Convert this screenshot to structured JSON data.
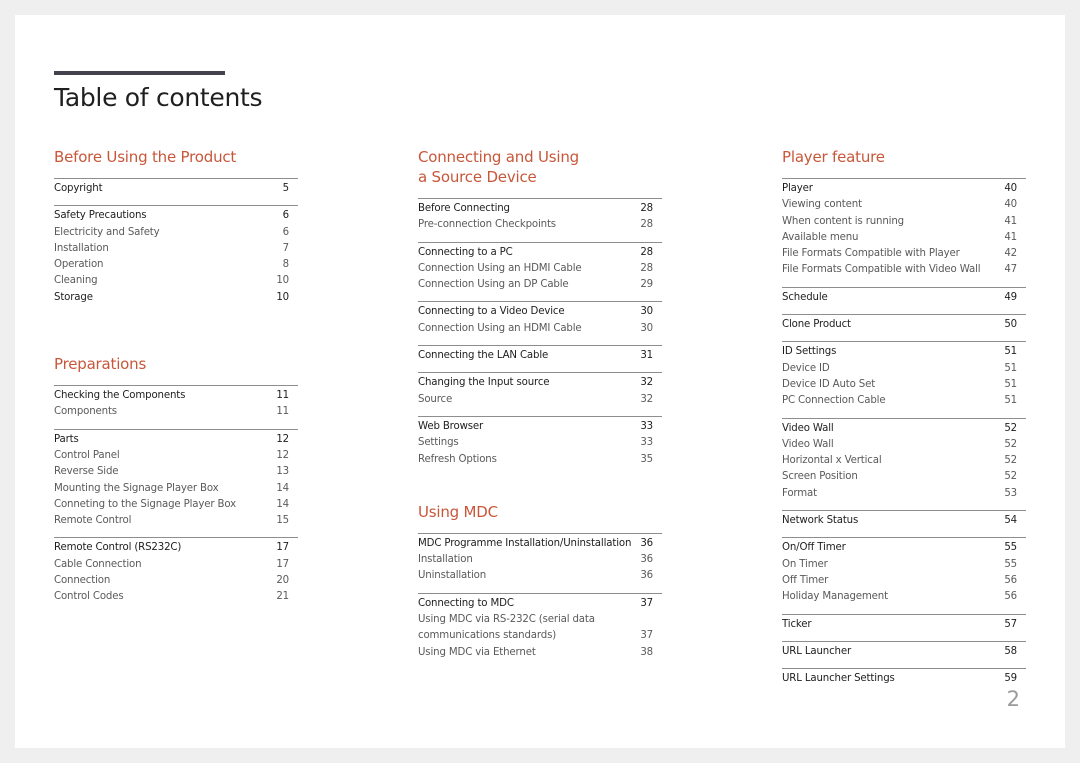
{
  "page": {
    "title": "Table of contents",
    "page_number": "2",
    "accent_color": "#c8573a"
  },
  "columns": [
    {
      "sections": [
        {
          "title": "Before Using the Product",
          "groups": [
            {
              "entries": [
                {
                  "label": "Copyright",
                  "page": "5",
                  "level": "main"
                }
              ]
            },
            {
              "entries": [
                {
                  "label": "Safety Precautions",
                  "page": "6",
                  "level": "main"
                },
                {
                  "label": "Electricity and Safety",
                  "page": "6",
                  "level": "sub"
                },
                {
                  "label": "Installation",
                  "page": "7",
                  "level": "sub"
                },
                {
                  "label": "Operation",
                  "page": "8",
                  "level": "sub"
                },
                {
                  "label": "Cleaning",
                  "page": "10",
                  "level": "sub"
                },
                {
                  "label": "Storage",
                  "page": "10",
                  "level": "main"
                }
              ]
            }
          ]
        },
        {
          "title": "Preparations",
          "groups": [
            {
              "entries": [
                {
                  "label": "Checking the Components",
                  "page": "11",
                  "level": "main"
                },
                {
                  "label": "Components",
                  "page": "11",
                  "level": "sub"
                }
              ]
            },
            {
              "entries": [
                {
                  "label": "Parts",
                  "page": "12",
                  "level": "main"
                },
                {
                  "label": "Control Panel",
                  "page": "12",
                  "level": "sub"
                },
                {
                  "label": "Reverse Side",
                  "page": "13",
                  "level": "sub"
                },
                {
                  "label": "Mounting the Signage Player Box",
                  "page": "14",
                  "level": "sub"
                },
                {
                  "label": "Conneting to the Signage Player Box",
                  "page": "14",
                  "level": "sub"
                },
                {
                  "label": "Remote Control",
                  "page": "15",
                  "level": "sub"
                }
              ]
            },
            {
              "entries": [
                {
                  "label": "Remote Control (RS232C)",
                  "page": "17",
                  "level": "main"
                },
                {
                  "label": "Cable Connection",
                  "page": "17",
                  "level": "sub"
                },
                {
                  "label": "Connection",
                  "page": "20",
                  "level": "sub"
                },
                {
                  "label": "Control Codes",
                  "page": "21",
                  "level": "sub"
                }
              ]
            }
          ]
        }
      ]
    },
    {
      "sections": [
        {
          "title": "Connecting and Using\na Source Device",
          "groups": [
            {
              "entries": [
                {
                  "label": "Before Connecting",
                  "page": "28",
                  "level": "main"
                },
                {
                  "label": "Pre-connection Checkpoints",
                  "page": "28",
                  "level": "sub"
                }
              ]
            },
            {
              "entries": [
                {
                  "label": "Connecting to a PC",
                  "page": "28",
                  "level": "main"
                },
                {
                  "label": "Connection Using an HDMI Cable",
                  "page": "28",
                  "level": "sub"
                },
                {
                  "label": "Connection Using an DP Cable",
                  "page": "29",
                  "level": "sub"
                }
              ]
            },
            {
              "entries": [
                {
                  "label": "Connecting to a Video Device",
                  "page": "30",
                  "level": "main"
                },
                {
                  "label": "Connection Using an HDMI Cable",
                  "page": "30",
                  "level": "sub"
                }
              ]
            },
            {
              "entries": [
                {
                  "label": "Connecting the LAN Cable",
                  "page": "31",
                  "level": "main"
                }
              ]
            },
            {
              "entries": [
                {
                  "label": "Changing the Input source",
                  "page": "32",
                  "level": "main"
                },
                {
                  "label": "Source",
                  "page": "32",
                  "level": "sub"
                }
              ]
            },
            {
              "entries": [
                {
                  "label": "Web Browser",
                  "page": "33",
                  "level": "main"
                },
                {
                  "label": "Settings",
                  "page": "33",
                  "level": "sub"
                },
                {
                  "label": "Refresh Options",
                  "page": "35",
                  "level": "sub"
                }
              ]
            }
          ]
        },
        {
          "title": "Using MDC",
          "groups": [
            {
              "entries": [
                {
                  "label": "MDC Programme Installation/Uninstallation",
                  "page": "36",
                  "level": "main"
                },
                {
                  "label": "Installation",
                  "page": "36",
                  "level": "sub"
                },
                {
                  "label": "Uninstallation",
                  "page": "36",
                  "level": "sub"
                }
              ]
            },
            {
              "entries": [
                {
                  "label": "Connecting to MDC",
                  "page": "37",
                  "level": "main"
                },
                {
                  "label": "Using MDC via RS-232C (serial data\ncommunications standards)",
                  "page": "37",
                  "level": "sub"
                },
                {
                  "label": "Using MDC via Ethernet",
                  "page": "38",
                  "level": "sub"
                }
              ]
            }
          ]
        }
      ]
    },
    {
      "sections": [
        {
          "title": "Player feature",
          "groups": [
            {
              "entries": [
                {
                  "label": "Player",
                  "page": "40",
                  "level": "main"
                },
                {
                  "label": "Viewing content",
                  "page": "40",
                  "level": "sub"
                },
                {
                  "label": "When content is running",
                  "page": "41",
                  "level": "sub"
                },
                {
                  "label": "Available menu",
                  "page": "41",
                  "level": "sub"
                },
                {
                  "label": "File Formats Compatible with Player",
                  "page": "42",
                  "level": "sub"
                },
                {
                  "label": "File Formats Compatible with Video Wall",
                  "page": "47",
                  "level": "sub"
                }
              ]
            },
            {
              "entries": [
                {
                  "label": "Schedule",
                  "page": "49",
                  "level": "main"
                }
              ]
            },
            {
              "entries": [
                {
                  "label": "Clone Product",
                  "page": "50",
                  "level": "main"
                }
              ]
            },
            {
              "entries": [
                {
                  "label": "ID Settings",
                  "page": "51",
                  "level": "main"
                },
                {
                  "label": "Device ID",
                  "page": "51",
                  "level": "sub"
                },
                {
                  "label": "Device ID Auto Set",
                  "page": "51",
                  "level": "sub"
                },
                {
                  "label": "PC Connection Cable",
                  "page": "51",
                  "level": "sub"
                }
              ]
            },
            {
              "entries": [
                {
                  "label": "Video Wall",
                  "page": "52",
                  "level": "main"
                },
                {
                  "label": "Video Wall",
                  "page": "52",
                  "level": "sub"
                },
                {
                  "label": "Horizontal x Vertical",
                  "page": "52",
                  "level": "sub"
                },
                {
                  "label": "Screen Position",
                  "page": "52",
                  "level": "sub"
                },
                {
                  "label": "Format",
                  "page": "53",
                  "level": "sub"
                }
              ]
            },
            {
              "entries": [
                {
                  "label": "Network Status",
                  "page": "54",
                  "level": "main"
                }
              ]
            },
            {
              "entries": [
                {
                  "label": "On/Off Timer",
                  "page": "55",
                  "level": "main"
                },
                {
                  "label": "On Timer",
                  "page": "55",
                  "level": "sub"
                },
                {
                  "label": "Off Timer",
                  "page": "56",
                  "level": "sub"
                },
                {
                  "label": "Holiday Management",
                  "page": "56",
                  "level": "sub"
                }
              ]
            },
            {
              "entries": [
                {
                  "label": "Ticker",
                  "page": "57",
                  "level": "main"
                }
              ]
            },
            {
              "entries": [
                {
                  "label": "URL Launcher",
                  "page": "58",
                  "level": "main"
                }
              ]
            },
            {
              "entries": [
                {
                  "label": "URL Launcher Settings",
                  "page": "59",
                  "level": "main"
                }
              ]
            }
          ]
        }
      ]
    }
  ]
}
